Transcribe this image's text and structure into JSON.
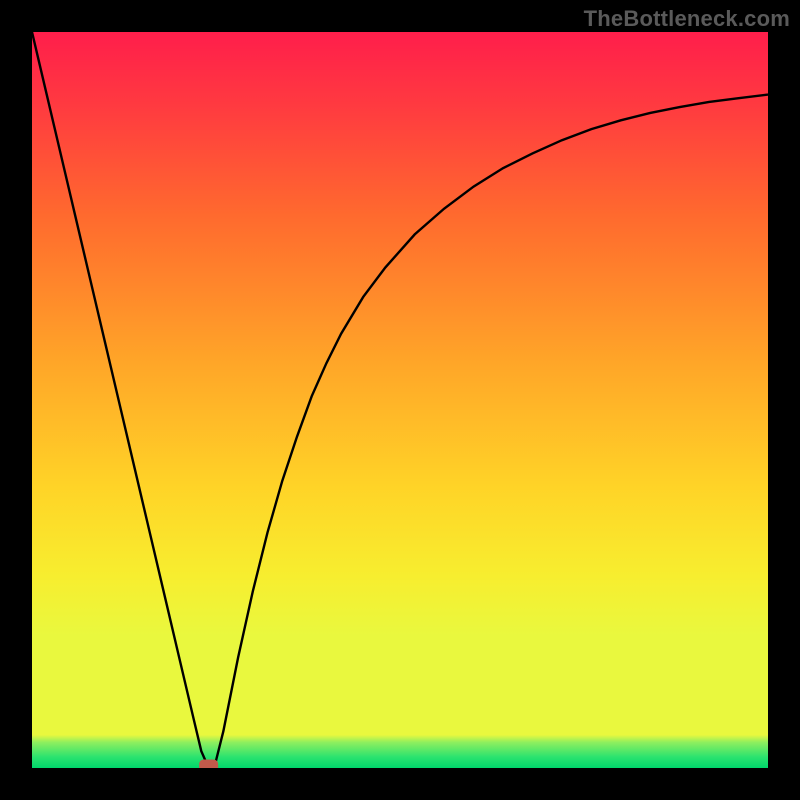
{
  "watermark": "TheBottleneck.com",
  "colors": {
    "frame": "#000000",
    "curve": "#000000",
    "marker_fill": "#C15A4B",
    "marker_stroke": "#C15A4B",
    "gradient_stops": [
      {
        "offset": 0.0,
        "color": "#FF1E4B"
      },
      {
        "offset": 0.1,
        "color": "#FF3A40"
      },
      {
        "offset": 0.25,
        "color": "#FF6A2E"
      },
      {
        "offset": 0.45,
        "color": "#FFA628"
      },
      {
        "offset": 0.62,
        "color": "#FFD427"
      },
      {
        "offset": 0.74,
        "color": "#F7EE2F"
      },
      {
        "offset": 0.82,
        "color": "#E9F83E"
      },
      {
        "offset": 0.955,
        "color": "#E9F83E"
      },
      {
        "offset": 0.965,
        "color": "#8FEF5E"
      },
      {
        "offset": 0.985,
        "color": "#2BE36F"
      },
      {
        "offset": 1.0,
        "color": "#00D66B"
      }
    ]
  },
  "chart_data": {
    "type": "line",
    "title": "",
    "xlabel": "",
    "ylabel": "",
    "x_range": [
      0,
      100
    ],
    "y_range": [
      0,
      100
    ],
    "x": [
      0,
      2,
      4,
      6,
      8,
      10,
      12,
      14,
      16,
      18,
      20,
      22,
      23,
      24,
      25,
      26,
      28,
      30,
      32,
      34,
      36,
      38,
      40,
      42,
      45,
      48,
      52,
      56,
      60,
      64,
      68,
      72,
      76,
      80,
      84,
      88,
      92,
      96,
      100
    ],
    "y": [
      100,
      91.5,
      83.0,
      74.5,
      66.0,
      57.5,
      49.0,
      40.5,
      32.0,
      23.5,
      15.0,
      6.5,
      2.3,
      0.0,
      1.0,
      5.0,
      15.0,
      24.0,
      32.0,
      39.0,
      45.0,
      50.5,
      55.0,
      59.0,
      64.0,
      68.0,
      72.5,
      76.0,
      79.0,
      81.5,
      83.5,
      85.3,
      86.8,
      88.0,
      89.0,
      89.8,
      90.5,
      91.0,
      91.5
    ],
    "marker": {
      "x": 24,
      "y": 0
    },
    "grid": false,
    "legend": false
  }
}
